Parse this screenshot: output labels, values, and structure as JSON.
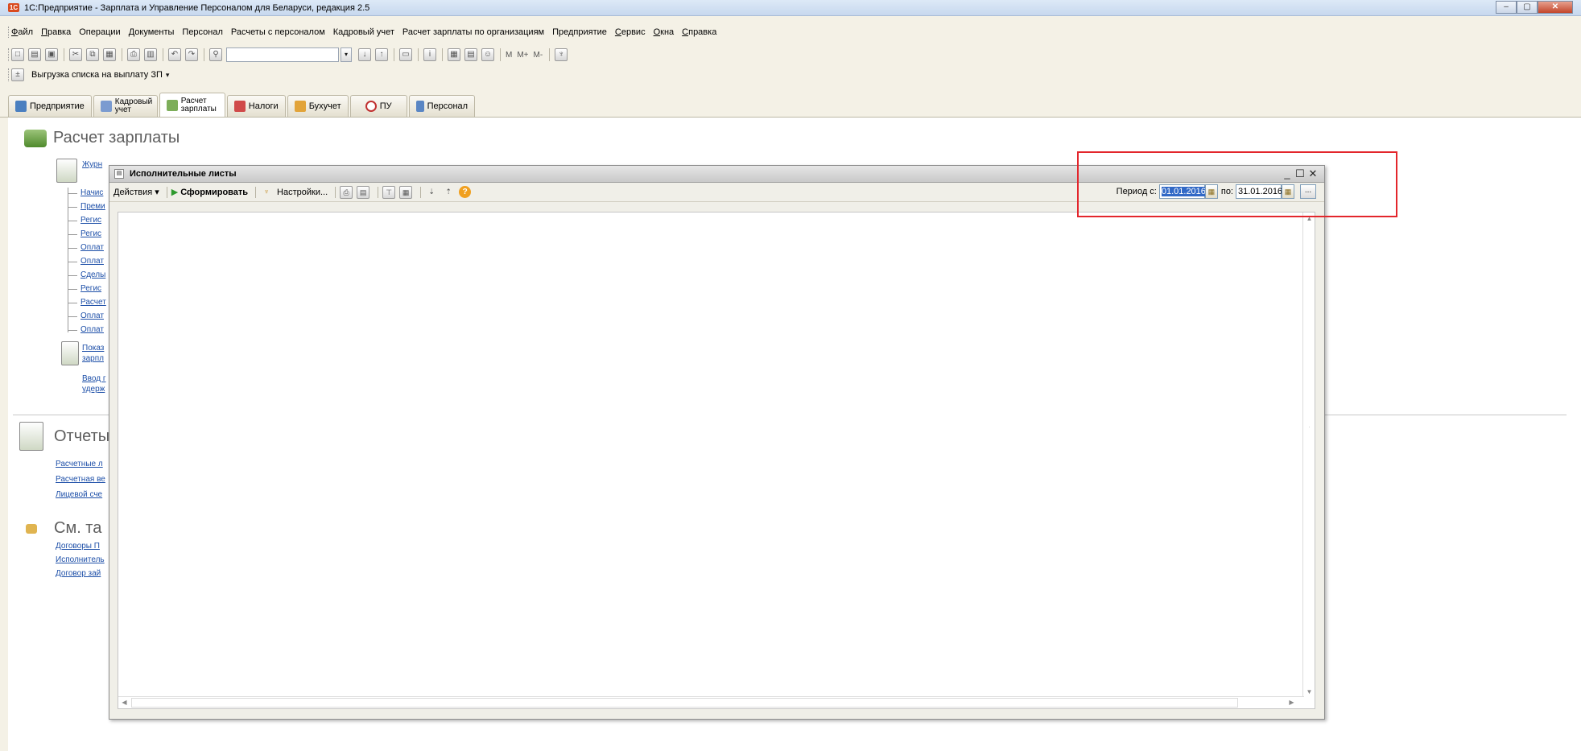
{
  "window": {
    "title": "1С:Предприятие - Зарплата и Управление Персоналом для Беларуси, редакция 2.5",
    "logo": "1С",
    "controls": [
      "–",
      "▢",
      "✕"
    ]
  },
  "menu": [
    "Файл",
    "Правка",
    "Операции",
    "Документы",
    "Персонал",
    "Расчеты с персоналом",
    "Кадровый учет",
    "Расчет зарплаты по организациям",
    "Предприятие",
    "Сервис",
    "Окна",
    "Справка"
  ],
  "toolbar2": {
    "label": "Выгрузка списка на выплату ЗП"
  },
  "tabs": [
    {
      "label": "Предприятие",
      "color": "#4a7fc0"
    },
    {
      "label": "Кадровый учет",
      "color": "#7b9bd0"
    },
    {
      "label": "Расчет зарплаты",
      "color": "#7dae5a"
    },
    {
      "label": "Налоги",
      "color": "#d04a4a"
    },
    {
      "label": "Бухучет",
      "color": "#e2a43a"
    },
    {
      "label": "ПУ",
      "color": "#c03030"
    },
    {
      "label": "Персонал",
      "color": "#5a86c4"
    }
  ],
  "page": {
    "title": "Расчет зарплаты",
    "journal_link": "Журн",
    "tree_links": [
      "Начис",
      "Преми",
      "Регис",
      "Регис",
      "Оплат",
      "Оплат",
      "Сделы",
      "Регис",
      "Расчет",
      "Оплат",
      "Оплат"
    ],
    "shows_link_1": "Показ",
    "shows_link_2": "зарпл",
    "input_link_1": "Ввод г",
    "input_link_2": "удерж",
    "reports_title": "Отчеты",
    "report_links": [
      "Расчетные л",
      "Расчетная ве",
      "Лицевой сче"
    ],
    "see_title": "См. та",
    "see_links": [
      "Договоры П",
      "Исполнитель",
      "Договор зай"
    ]
  },
  "modal": {
    "title": "Исполнительные листы",
    "actions_label": "Действия ▾",
    "generate_label": "Сформировать",
    "settings_label": "Настройки...",
    "period_from_label": "Период с:",
    "period_from_value": "01.01.2016",
    "period_to_label": "по:",
    "period_to_value": "31.01.2016",
    "dots_label": "...",
    "controls": [
      "_",
      "☐",
      "✕"
    ]
  }
}
